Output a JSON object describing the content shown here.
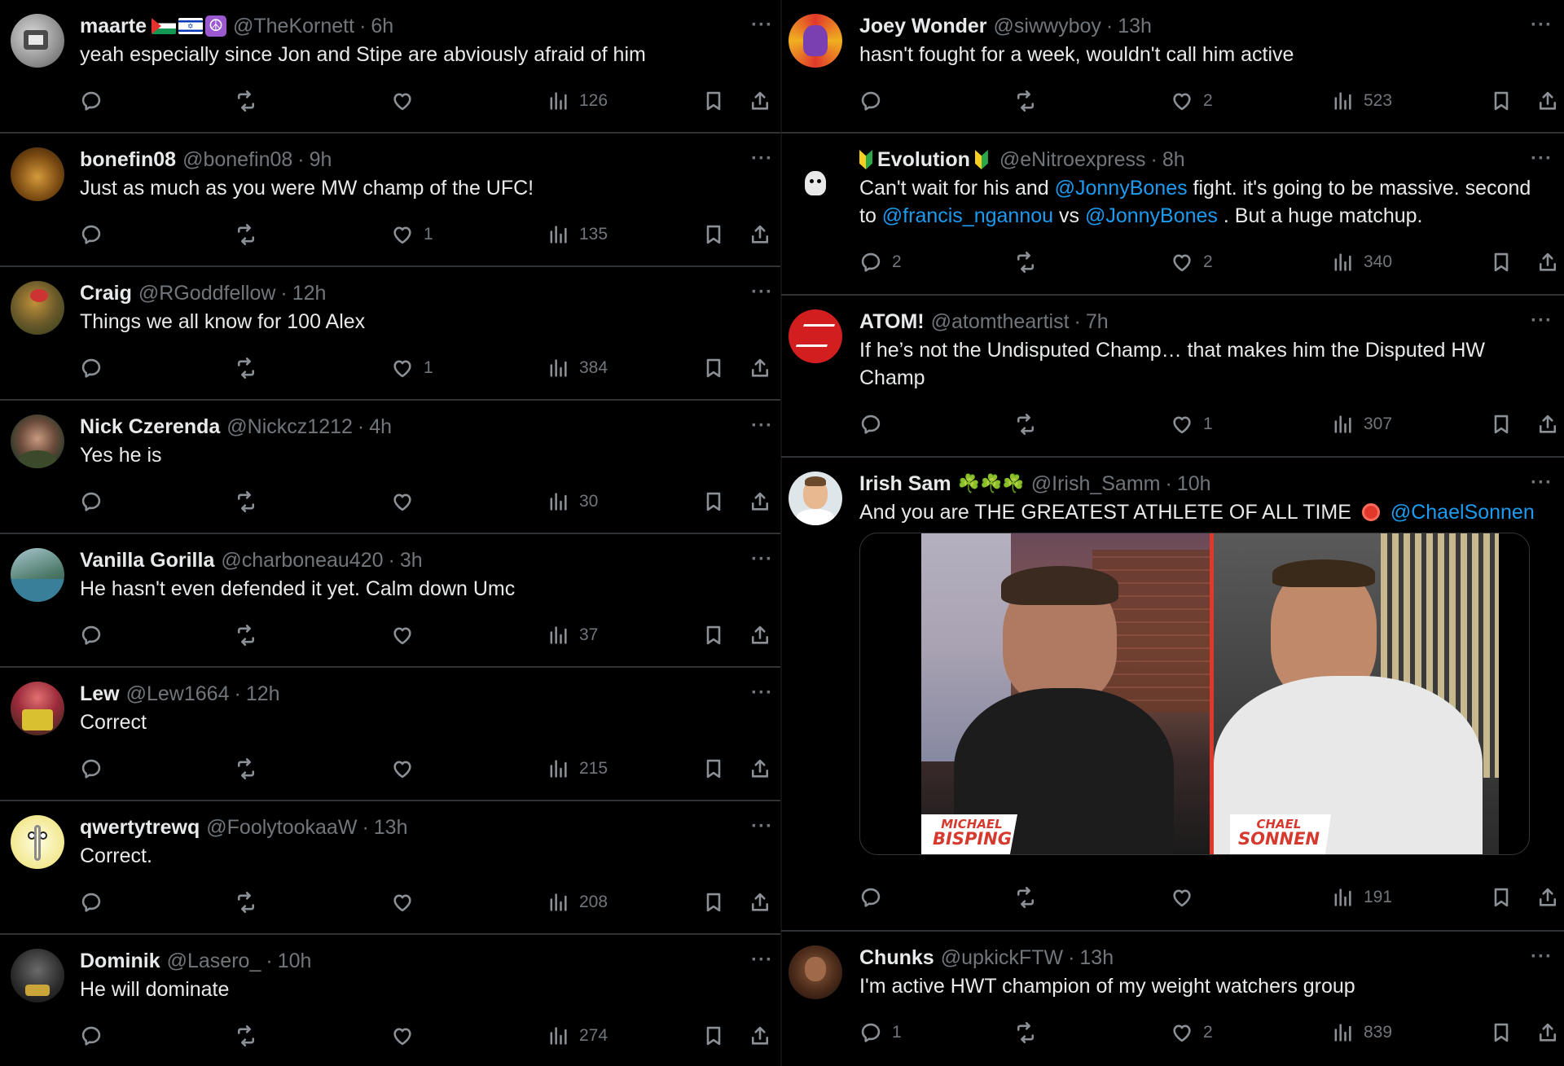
{
  "colors": {
    "background": "#000000",
    "text": "#e7e9ea",
    "muted": "#71767b",
    "divider": "#2f3336",
    "link": "#1d9bf0"
  },
  "left_column": [
    {
      "name": "maarte",
      "handle": "@TheKornett",
      "time": "6h",
      "badges": [
        "palestine-flag",
        "israel-flag",
        "peace-symbol"
      ],
      "text": "yeah especially since Jon and Stipe are abviously afraid of him",
      "replies": "",
      "likes": "",
      "views": "126"
    },
    {
      "name": "bonefin08",
      "handle": "@bonefin08",
      "time": "9h",
      "text": "Just as much as you were MW champ of the UFC!",
      "replies": "",
      "likes": "1",
      "views": "135"
    },
    {
      "name": "Craig",
      "handle": "@RGoddfellow",
      "time": "12h",
      "text": "Things we all know for 100 Alex",
      "replies": "",
      "likes": "1",
      "views": "384"
    },
    {
      "name": "Nick Czerenda",
      "handle": "@Nickcz1212",
      "time": "4h",
      "text": "Yes he is",
      "replies": "",
      "likes": "",
      "views": "30"
    },
    {
      "name": "Vanilla Gorilla",
      "handle": "@charboneau420",
      "time": "3h",
      "text": "He hasn't even defended it yet. Calm down Umc",
      "replies": "",
      "likes": "",
      "views": "37"
    },
    {
      "name": "Lew",
      "handle": "@Lew1664",
      "time": "12h",
      "text": "Correct",
      "replies": "",
      "likes": "",
      "views": "215"
    },
    {
      "name": "qwertytrewq",
      "handle": "@FoolytookaaW",
      "time": "13h",
      "text": "Correct.",
      "replies": "",
      "likes": "",
      "views": "208"
    },
    {
      "name": "Dominik",
      "handle": "@Lasero_",
      "time": "10h",
      "text": "He will dominate",
      "replies": "",
      "likes": "",
      "views": "274"
    }
  ],
  "right_column": {
    "joey": {
      "name": "Joey Wonder",
      "handle": "@siwwyboy",
      "time": "13h",
      "text": "hasn't fought for a week, wouldn't call him active",
      "replies": "",
      "likes": "2",
      "views": "523"
    },
    "evolution": {
      "name": "Evolution",
      "handle": "@eNitroexpress",
      "time": "8h",
      "badge": "beginner-leaf-emoji",
      "text_1": "Can't wait for his and ",
      "mention_1": "@JonnyBones",
      "text_2": "  fight. it's going to be massive. second",
      "text_3": "to ",
      "mention_2": "@francis_ngannou",
      "text_4": " vs ",
      "mention_3": "@JonnyBones",
      "text_5": " . But a huge matchup.",
      "replies": "2",
      "likes": "2",
      "views": "340"
    },
    "atom": {
      "name": "ATOM!",
      "handle": "@atomtheartist",
      "time": "7h",
      "text_line1": "If he’s not the Undisputed Champ… that makes him the Disputed HW",
      "text_line2": "Champ",
      "replies": "",
      "likes": "1",
      "views": "307"
    },
    "irish": {
      "name": "Irish Sam",
      "name_suffix": "☘️☘️☘️",
      "handle": "@Irish_Samm",
      "time": "10h",
      "text": "And you are THE GREATEST ATHLETE OF ALL TIME",
      "mention": "@ChaelSonnen",
      "media": {
        "left_caption_top": "MICHAEL",
        "left_caption_bottom": "BISPING",
        "right_caption_top": "CHAEL",
        "right_caption_bottom": "SONNEN",
        "left_caption_color": "#d63a2f"
      },
      "replies": "",
      "likes": "",
      "views": "191"
    },
    "chunks": {
      "name": "Chunks",
      "handle": "@upkickFTW",
      "time": "13h",
      "text": "I'm active HWT champion of my weight watchers group",
      "replies": "1",
      "likes": "2",
      "views": "839"
    }
  },
  "meta_separator": "·",
  "more_label": "···"
}
